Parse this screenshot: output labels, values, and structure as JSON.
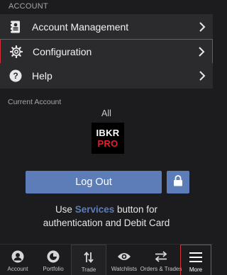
{
  "section_header": "ACCOUNT",
  "menu": [
    {
      "label": "Account Management",
      "icon": "account-management-icon"
    },
    {
      "label": "Configuration",
      "icon": "gear-icon"
    },
    {
      "label": "Help",
      "icon": "help-icon"
    }
  ],
  "current_account": {
    "label": "Current Account",
    "value": "All",
    "logo_top": "IBKR",
    "logo_bottom": "PRO"
  },
  "logout": {
    "label": "Log Out",
    "lock_icon": "lock-icon"
  },
  "services_note": {
    "prefix": "Use ",
    "highlight": "Services",
    "suffix": " button for",
    "line2": "authentication and Debit Card"
  },
  "tabs": [
    {
      "label": "Account",
      "icon": "account-icon"
    },
    {
      "label": "Portfolio",
      "icon": "portfolio-icon"
    },
    {
      "label": "Trade",
      "icon": "trade-icon"
    },
    {
      "label": "Watchlists",
      "icon": "watchlists-icon"
    },
    {
      "label": "Orders & Trades",
      "icon": "orders-trades-icon"
    },
    {
      "label": "More",
      "icon": "menu-icon"
    }
  ],
  "colors": {
    "background": "#1c1c1e",
    "row": "#2b2b2e",
    "accent_blue": "#5d7db9",
    "highlight_red": "#d0313a",
    "logo_red": "#e4202b"
  }
}
